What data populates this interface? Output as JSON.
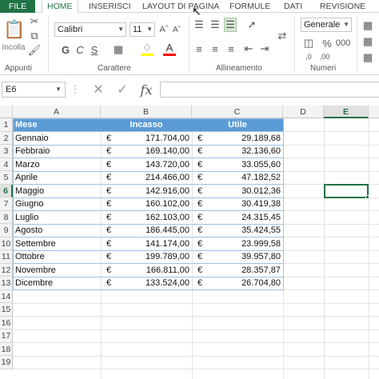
{
  "tabs": [
    "FILE",
    "HOME",
    "INSERISCI",
    "LAYOUT DI PAGINA",
    "FORMULE",
    "DATI",
    "REVISIONE"
  ],
  "active_tab": "HOME",
  "ribbon": {
    "paste_label": "Incolla",
    "font_name": "Calibri",
    "font_size": "11",
    "bold": "G",
    "italic": "C",
    "underline": "S",
    "number_format": "Generale",
    "groups": [
      "Appunti",
      "Carattere",
      "Allineamento",
      "Numeri"
    ]
  },
  "name_box": "E6",
  "formula_symbol": "fx",
  "columns": [
    "A",
    "B",
    "C",
    "D",
    "E"
  ],
  "selected_column": "E",
  "rows": [
    "1",
    "2",
    "3",
    "4",
    "5",
    "6",
    "7",
    "8",
    "9",
    "10",
    "11",
    "12",
    "13",
    "14",
    "15",
    "16",
    "17",
    "18",
    "19"
  ],
  "selected_row": "6",
  "table": {
    "headers": [
      "Mese",
      "Incasso",
      "Utile"
    ],
    "currency": "€",
    "rows": [
      {
        "mese": "Gennaio",
        "incasso": "171.704,00",
        "utile": "29.189,68"
      },
      {
        "mese": "Febbraio",
        "incasso": "169.140,00",
        "utile": "32.136,60"
      },
      {
        "mese": "Marzo",
        "incasso": "143.720,00",
        "utile": "33.055,60"
      },
      {
        "mese": "Aprile",
        "incasso": "214.466,00",
        "utile": "47.182,52"
      },
      {
        "mese": "Maggio",
        "incasso": "142.916,00",
        "utile": "30.012,36"
      },
      {
        "mese": "Giugno",
        "incasso": "160.102,00",
        "utile": "30.419,38"
      },
      {
        "mese": "Luglio",
        "incasso": "162.103,00",
        "utile": "24.315,45"
      },
      {
        "mese": "Agosto",
        "incasso": "186.445,00",
        "utile": "35.424,55"
      },
      {
        "mese": "Settembre",
        "incasso": "141.174,00",
        "utile": "23.999,58"
      },
      {
        "mese": "Ottobre",
        "incasso": "199.789,00",
        "utile": "39.957,80"
      },
      {
        "mese": "Novembre",
        "incasso": "166.811,00",
        "utile": "28.357,87"
      },
      {
        "mese": "Dicembre",
        "incasso": "133.524,00",
        "utile": "26.704,80"
      }
    ]
  },
  "colors": {
    "accent": "#217346",
    "table_header": "#5b9bd5",
    "table_border": "#9bc2e6"
  }
}
